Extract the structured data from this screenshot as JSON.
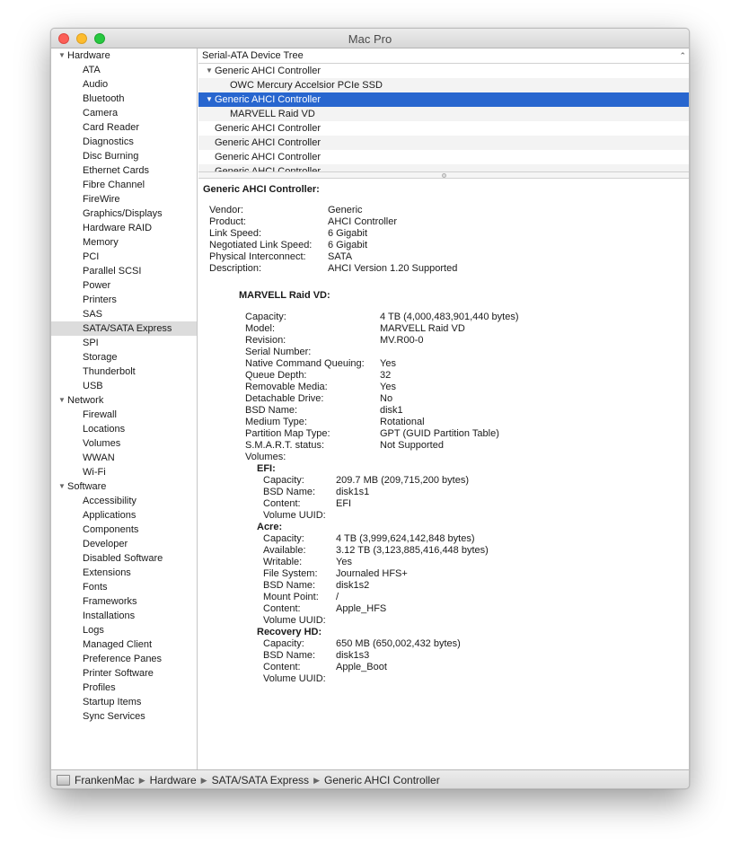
{
  "window": {
    "title": "Mac Pro"
  },
  "sidebar": {
    "groups": [
      {
        "label": "Hardware",
        "items": [
          "ATA",
          "Audio",
          "Bluetooth",
          "Camera",
          "Card Reader",
          "Diagnostics",
          "Disc Burning",
          "Ethernet Cards",
          "Fibre Channel",
          "FireWire",
          "Graphics/Displays",
          "Hardware RAID",
          "Memory",
          "PCI",
          "Parallel SCSI",
          "Power",
          "Printers",
          "SAS",
          "SATA/SATA Express",
          "SPI",
          "Storage",
          "Thunderbolt",
          "USB"
        ]
      },
      {
        "label": "Network",
        "items": [
          "Firewall",
          "Locations",
          "Volumes",
          "WWAN",
          "Wi-Fi"
        ]
      },
      {
        "label": "Software",
        "items": [
          "Accessibility",
          "Applications",
          "Components",
          "Developer",
          "Disabled Software",
          "Extensions",
          "Fonts",
          "Frameworks",
          "Installations",
          "Logs",
          "Managed Client",
          "Preference Panes",
          "Printer Software",
          "Profiles",
          "Startup Items",
          "Sync Services"
        ]
      }
    ],
    "selected": "SATA/SATA Express"
  },
  "tree": {
    "header": "Serial-ATA Device Tree",
    "sort_icon": "chevron-up-icon",
    "rows": [
      {
        "label": "Generic AHCI Controller",
        "level": 0,
        "expanded": true
      },
      {
        "label": "OWC Mercury Accelsior PCIe SSD",
        "level": 1
      },
      {
        "label": "Generic AHCI Controller",
        "level": 0,
        "expanded": true,
        "selected": true
      },
      {
        "label": "MARVELL Raid VD",
        "level": 1
      },
      {
        "label": "Generic AHCI Controller",
        "level": 0
      },
      {
        "label": "Generic AHCI Controller",
        "level": 0
      },
      {
        "label": "Generic AHCI Controller",
        "level": 0
      },
      {
        "label": "Generic AHCI Controller",
        "level": 0
      }
    ]
  },
  "detail": {
    "title": "Generic AHCI Controller:",
    "controller_props": [
      {
        "k": "Vendor:",
        "v": "Generic"
      },
      {
        "k": "Product:",
        "v": "AHCI Controller"
      },
      {
        "k": "Link Speed:",
        "v": "6 Gigabit"
      },
      {
        "k": "Negotiated Link Speed:",
        "v": "6 Gigabit"
      },
      {
        "k": "Physical Interconnect:",
        "v": "SATA"
      },
      {
        "k": "Description:",
        "v": "AHCI Version 1.20 Supported"
      }
    ],
    "device_title": "MARVELL Raid VD:",
    "device_props": [
      {
        "k": "Capacity:",
        "v": "4 TB (4,000,483,901,440 bytes)"
      },
      {
        "k": "Model:",
        "v": "MARVELL Raid VD"
      },
      {
        "k": "Revision:",
        "v": "MV.R00-0"
      },
      {
        "k": "Serial Number:",
        "v": ""
      },
      {
        "k": "Native Command Queuing:",
        "v": "Yes"
      },
      {
        "k": "Queue Depth:",
        "v": "32"
      },
      {
        "k": "Removable Media:",
        "v": "Yes"
      },
      {
        "k": "Detachable Drive:",
        "v": "No"
      },
      {
        "k": "BSD Name:",
        "v": "disk1"
      },
      {
        "k": "Medium Type:",
        "v": "Rotational"
      },
      {
        "k": "Partition Map Type:",
        "v": "GPT (GUID Partition Table)"
      },
      {
        "k": "S.M.A.R.T. status:",
        "v": "Not Supported"
      },
      {
        "k": "Volumes:",
        "v": ""
      }
    ],
    "volumes": [
      {
        "name": "EFI:",
        "props": [
          {
            "k": "Capacity:",
            "v": "209.7 MB (209,715,200 bytes)"
          },
          {
            "k": "BSD Name:",
            "v": "disk1s1"
          },
          {
            "k": "Content:",
            "v": "EFI"
          },
          {
            "k": "Volume UUID:",
            "v": ""
          }
        ]
      },
      {
        "name": "Acre:",
        "props": [
          {
            "k": "Capacity:",
            "v": "4 TB (3,999,624,142,848 bytes)"
          },
          {
            "k": "Available:",
            "v": "3.12 TB (3,123,885,416,448 bytes)"
          },
          {
            "k": "Writable:",
            "v": "Yes"
          },
          {
            "k": "File System:",
            "v": "Journaled HFS+"
          },
          {
            "k": "BSD Name:",
            "v": "disk1s2"
          },
          {
            "k": "Mount Point:",
            "v": "/"
          },
          {
            "k": "Content:",
            "v": "Apple_HFS"
          },
          {
            "k": "Volume UUID:",
            "v": ""
          }
        ]
      },
      {
        "name": "Recovery HD:",
        "props": [
          {
            "k": "Capacity:",
            "v": "650 MB (650,002,432 bytes)"
          },
          {
            "k": "BSD Name:",
            "v": "disk1s3"
          },
          {
            "k": "Content:",
            "v": "Apple_Boot"
          },
          {
            "k": "Volume UUID:",
            "v": ""
          }
        ]
      }
    ]
  },
  "statusbar": {
    "icon": "computer-icon",
    "crumbs": [
      "FrankenMac",
      "Hardware",
      "SATA/SATA Express",
      "Generic AHCI Controller"
    ]
  },
  "colors": {
    "selection": "#2866cf",
    "sidebar_selection": "#dcdcdc"
  }
}
